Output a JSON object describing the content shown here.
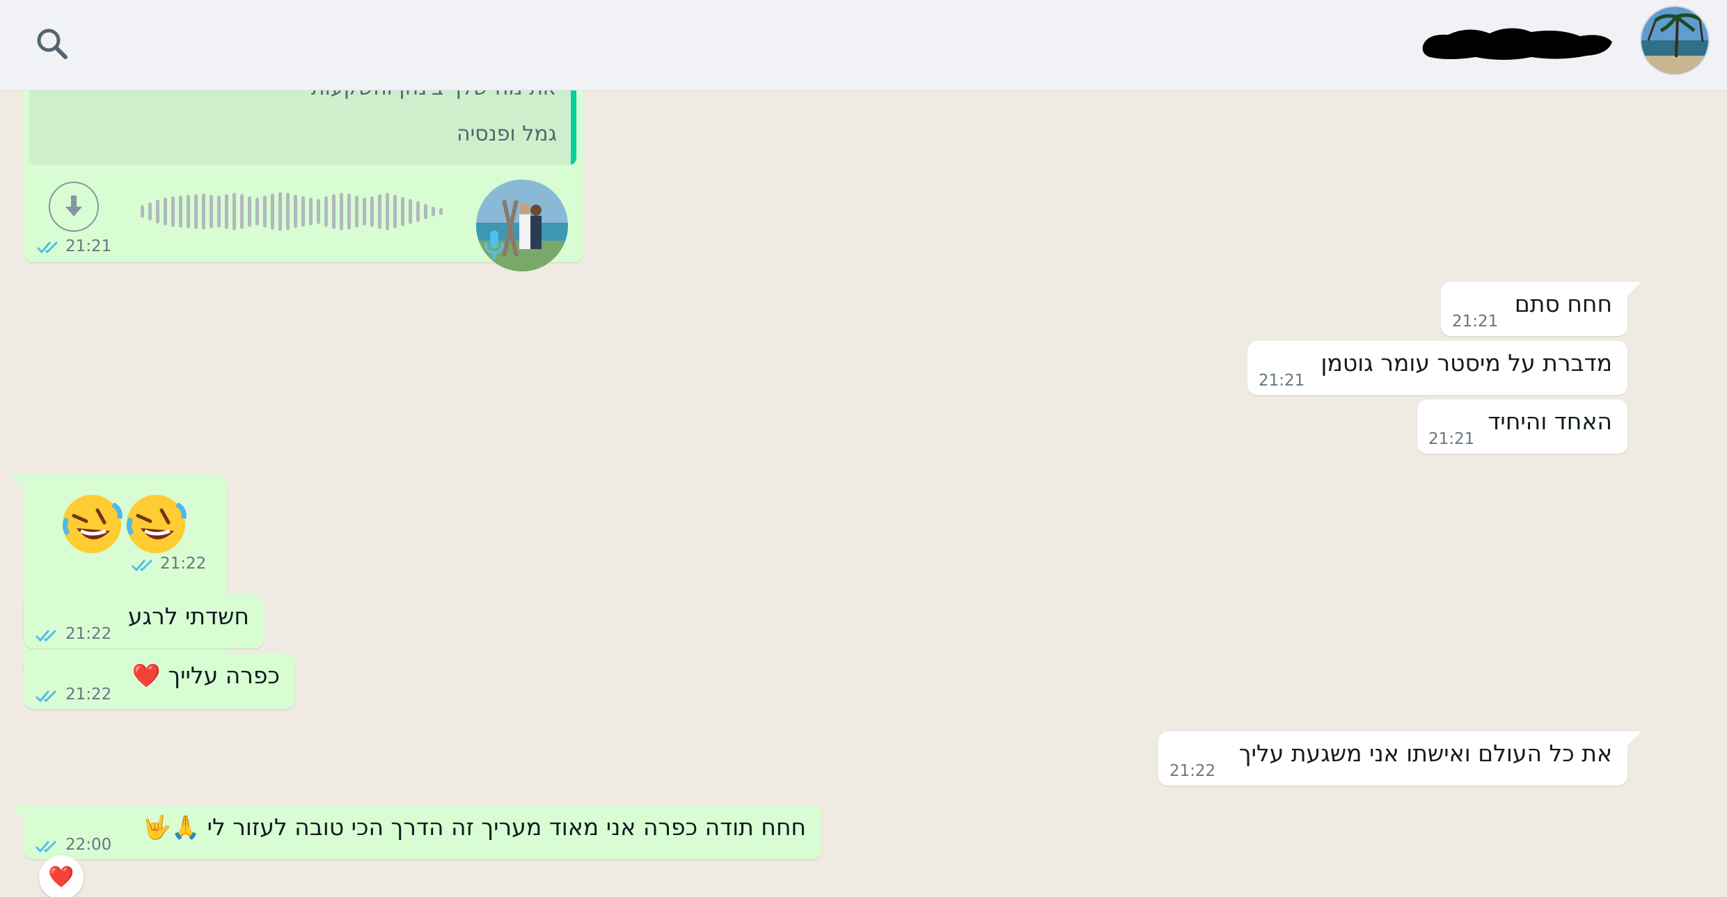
{
  "header": {
    "search_icon": "search-icon",
    "contact_name": "",
    "avatar_icon": "contact-avatar"
  },
  "colors": {
    "outgoing_bubble": "#d9fdd3",
    "incoming_bubble": "#ffffff",
    "read_ticks": "#53bdeb",
    "quote_bar": "#06cf9c",
    "background": "#efeae2"
  },
  "messages": [
    {
      "side": "left",
      "type": "voice",
      "quote_text_prev": "את מה שלך בינהן והשקעות",
      "quote_text": "גמל ופנסיה",
      "time": "21:21",
      "download_icon": "download-icon",
      "mic_icon": "mic-icon"
    },
    {
      "side": "right",
      "text": "חחח סתם",
      "time": "21:21"
    },
    {
      "side": "right",
      "text": "מדברת על מיסטר עומר גוטמן",
      "time": "21:21"
    },
    {
      "side": "right",
      "text": "האחד והיחיד",
      "time": "21:21"
    },
    {
      "side": "left",
      "text": "🤣🤣",
      "time": "21:22"
    },
    {
      "side": "left",
      "text": "חשדתי לרגע",
      "time": "21:22"
    },
    {
      "side": "left",
      "text": "כפרה עלייך ❤️",
      "time": "21:22"
    },
    {
      "side": "right",
      "text": "את כל העולם ואישתו אני משגעת עליך",
      "time": "21:22"
    },
    {
      "side": "left",
      "text": "חחח תודה כפרה אני מאוד מעריך זה הדרך הכי טובה לעזור לי 🙏🤟",
      "time": "22:00",
      "reaction": "❤️"
    }
  ]
}
